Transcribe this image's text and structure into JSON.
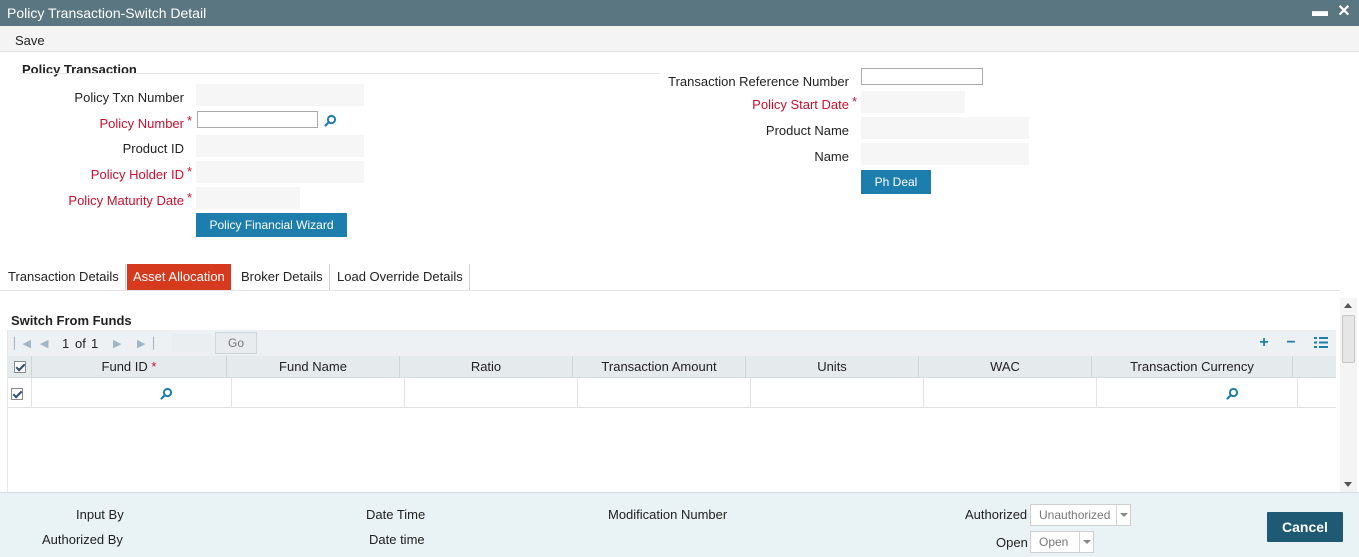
{
  "window": {
    "title": "Policy Transaction-Switch Detail",
    "minimize_glyph": "▬",
    "close_glyph": "✕"
  },
  "toolbar": {
    "save_label": "Save"
  },
  "policy_section": {
    "title": "Policy Transaction",
    "policy_txn_number_label": "Policy Txn Number",
    "policy_number_label": "Policy Number",
    "product_id_label": "Product ID",
    "policy_holder_id_label": "Policy Holder ID",
    "policy_maturity_date_label": "Policy Maturity Date",
    "policy_financial_wizard_button": "Policy Financial Wizard",
    "transaction_reference_number_label": "Transaction Reference Number",
    "policy_start_date_label": "Policy Start Date",
    "product_name_label": "Product Name",
    "name_label": "Name",
    "ph_deal_button": "Ph Deal",
    "required_marker": "*",
    "values": {
      "policy_txn_number": "",
      "policy_number": "",
      "product_id": "",
      "policy_holder_id": "",
      "policy_maturity_date": "",
      "transaction_reference_number": "",
      "policy_start_date": "",
      "product_name": "",
      "name": ""
    }
  },
  "tabs": [
    {
      "label": "Transaction Details",
      "active": false
    },
    {
      "label": "Asset Allocation",
      "active": true
    },
    {
      "label": "Broker Details",
      "active": false
    },
    {
      "label": "Load Override Details",
      "active": false
    }
  ],
  "switch_from_funds": {
    "title": "Switch From Funds",
    "pagination": {
      "current": "1",
      "of_label": "of",
      "total": "1",
      "go_label": "Go"
    },
    "columns": [
      "Fund ID",
      "Fund Name",
      "Ratio",
      "Transaction Amount",
      "Units",
      "WAC",
      "Transaction Currency"
    ],
    "required_marker": "*",
    "rows": [
      {
        "checked": true,
        "fund_id": "",
        "fund_name": "",
        "ratio": "",
        "transaction_amount": "",
        "units": "",
        "wac": "",
        "transaction_currency": ""
      }
    ]
  },
  "footer": {
    "input_by_label": "Input By",
    "authorized_by_label": "Authorized By",
    "date_time_label": "Date Time",
    "date_time_label_2": "Date time",
    "modification_number_label": "Modification Number",
    "authorized_label": "Authorized",
    "authorized_value": "Unauthorized",
    "open_label": "Open",
    "open_value": "Open",
    "cancel_button": "Cancel"
  },
  "colors": {
    "titlebar": "#5a7680",
    "accent_blue": "#1d7eae",
    "active_tab": "#d63a1e",
    "required_red": "#c8102e",
    "cancel_button": "#1e5a73",
    "footer_bg": "#e9f2f4"
  }
}
